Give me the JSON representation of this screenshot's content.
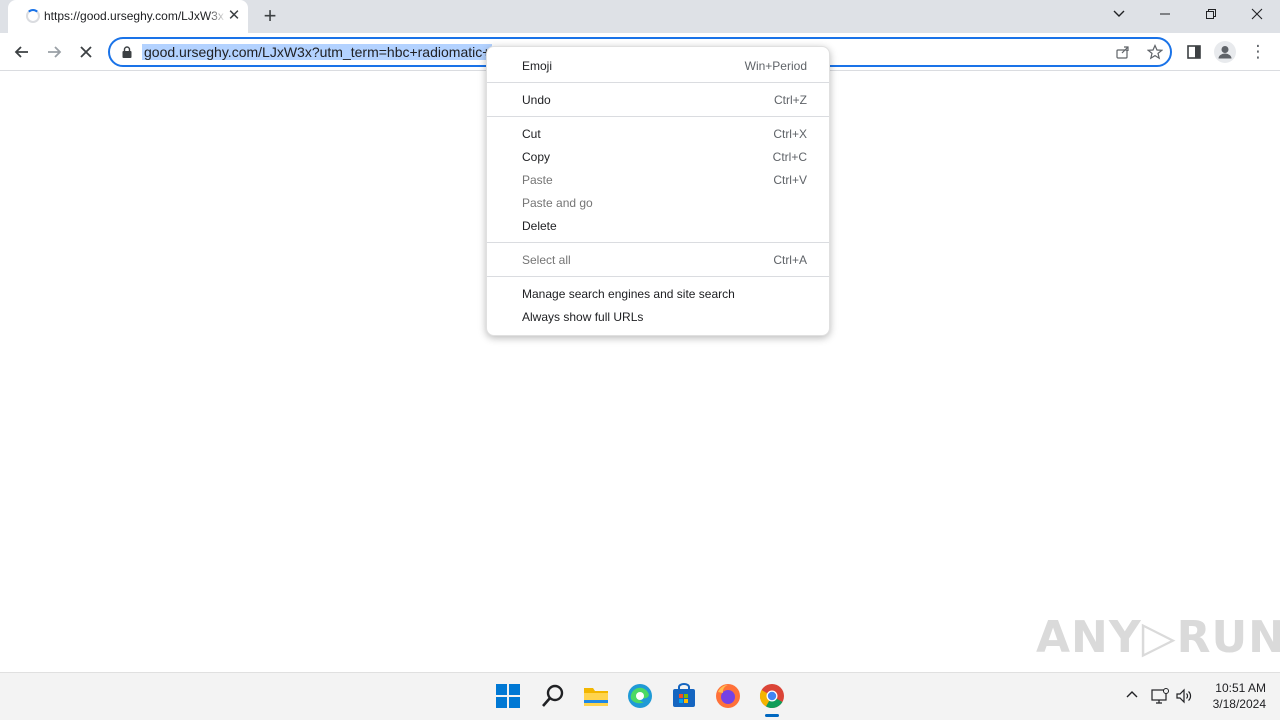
{
  "tab": {
    "title": "https://good.urseghy.com/LJxW3x",
    "close": "✕"
  },
  "newtab": "+",
  "window_controls": {
    "dropdown": "⌄",
    "minimize": "—",
    "restore": "❐",
    "close": "✕"
  },
  "toolbar": {
    "back": "←",
    "forward": "→",
    "stop": "✕",
    "menu": "⋮"
  },
  "omnibox": {
    "url": "good.urseghy.com/LJxW3x?utm_term=hbc+radiomatic+"
  },
  "context_menu": {
    "items": [
      {
        "label": "Emoji",
        "shortcut": "Win+Period",
        "enabled": true
      },
      {
        "label": "Undo",
        "shortcut": "Ctrl+Z",
        "enabled": true
      },
      {
        "label": "Cut",
        "shortcut": "Ctrl+X",
        "enabled": true
      },
      {
        "label": "Copy",
        "shortcut": "Ctrl+C",
        "enabled": true
      },
      {
        "label": "Paste",
        "shortcut": "Ctrl+V",
        "enabled": false
      },
      {
        "label": "Paste and go",
        "shortcut": "",
        "enabled": false
      },
      {
        "label": "Delete",
        "shortcut": "",
        "enabled": true
      },
      {
        "label": "Select all",
        "shortcut": "Ctrl+A",
        "enabled": false
      },
      {
        "label": "Manage search engines and site search",
        "shortcut": "",
        "enabled": true
      },
      {
        "label": "Always show full URLs",
        "shortcut": "",
        "enabled": true
      }
    ]
  },
  "watermark": "ANY▷RUN",
  "taskbar": {
    "icons": [
      "windows-start-icon",
      "search-icon",
      "file-explorer-icon",
      "edge-icon",
      "store-icon",
      "firefox-icon",
      "chrome-icon"
    ],
    "clock": {
      "time": "10:51 AM",
      "date": "3/18/2024"
    },
    "tray": {
      "chevron": "^"
    }
  },
  "colors": {
    "accent": "#1a73e8",
    "selection": "#b3d2ff",
    "tabstrip": "#dee1e6"
  }
}
